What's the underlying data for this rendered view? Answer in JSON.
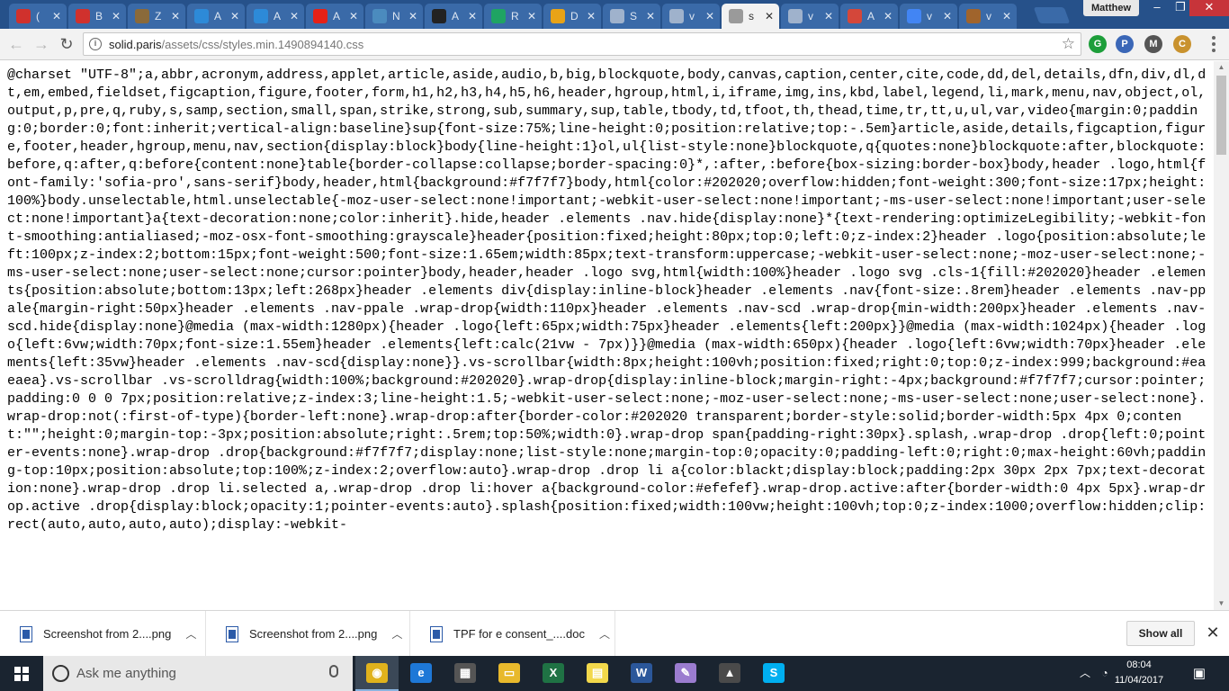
{
  "browser": {
    "tabs": [
      {
        "title": "(",
        "icon": "red-wave-icon",
        "color": "#d0312d"
      },
      {
        "title": "B",
        "icon": "red-wave-icon",
        "color": "#d0312d"
      },
      {
        "title": "Z",
        "icon": "zillow-icon",
        "color": "#8a6a3a"
      },
      {
        "title": "A",
        "icon": "s-logo-icon",
        "color": "#2d8ad8"
      },
      {
        "title": "A",
        "icon": "s-logo-icon",
        "color": "#2d8ad8"
      },
      {
        "title": "A",
        "icon": "youtube-icon",
        "color": "#e62117"
      },
      {
        "title": "N",
        "icon": "python-icon",
        "color": "#4b8bbe"
      },
      {
        "title": "A",
        "icon": "amazon-icon",
        "color": "#222222"
      },
      {
        "title": "R",
        "icon": "drive-icon",
        "color": "#1fa463"
      },
      {
        "title": "D",
        "icon": "download-icon",
        "color": "#e8a317"
      },
      {
        "title": "S",
        "icon": "document-icon",
        "color": "#9fb2cc"
      },
      {
        "title": "v",
        "icon": "document-icon",
        "color": "#9fb2cc"
      },
      {
        "title": "s",
        "icon": "document-icon",
        "color": "#9a9a9a",
        "active": true
      },
      {
        "title": "v",
        "icon": "document-icon",
        "color": "#9fb2cc"
      },
      {
        "title": "A",
        "icon": "tile-icon",
        "color": "#d4473a"
      },
      {
        "title": "v",
        "icon": "google-icon",
        "color": "#4285f4"
      },
      {
        "title": "v",
        "icon": "bug-icon",
        "color": "#a0642c"
      }
    ],
    "tab_close_glyph": "✕",
    "user_name": "Matthew",
    "window_controls": [
      "‒",
      "❐",
      "✕"
    ],
    "nav": {
      "back": "←",
      "forward": "→",
      "reload": "↻"
    },
    "address": {
      "info_glyph": "i",
      "host": "solid.paris",
      "path": "/assets/css/styles.min.1490894140.css"
    },
    "bookmark_glyph": "☆",
    "extensions": [
      {
        "name": "green-extension-icon",
        "label": "G",
        "color": "#1d9e3a"
      },
      {
        "name": "person-extension-icon",
        "label": "P",
        "color": "#3b67b7"
      },
      {
        "name": "gmail-extension-icon",
        "label": "M",
        "color": "#555555"
      },
      {
        "name": "cookie-extension-icon",
        "label": "C",
        "color": "#c9922e"
      }
    ]
  },
  "page": {
    "css_text": "@charset \"UTF-8\";a,abbr,acronym,address,applet,article,aside,audio,b,big,blockquote,body,canvas,caption,center,cite,code,dd,del,details,dfn,div,dl,dt,em,embed,fieldset,figcaption,figure,footer,form,h1,h2,h3,h4,h5,h6,header,hgroup,html,i,iframe,img,ins,kbd,label,legend,li,mark,menu,nav,object,ol,output,p,pre,q,ruby,s,samp,section,small,span,strike,strong,sub,summary,sup,table,tbody,td,tfoot,th,thead,time,tr,tt,u,ul,var,video{margin:0;padding:0;border:0;font:inherit;vertical-align:baseline}sup{font-size:75%;line-height:0;position:relative;top:-.5em}article,aside,details,figcaption,figure,footer,header,hgroup,menu,nav,section{display:block}body{line-height:1}ol,ul{list-style:none}blockquote,q{quotes:none}blockquote:after,blockquote:before,q:after,q:before{content:none}table{border-collapse:collapse;border-spacing:0}*,:after,:before{box-sizing:border-box}body,header .logo,html{font-family:'sofia-pro',sans-serif}body,header,html{background:#f7f7f7}body,html{color:#202020;overflow:hidden;font-weight:300;font-size:17px;height:100%}body.unselectable,html.unselectable{-moz-user-select:none!important;-webkit-user-select:none!important;-ms-user-select:none!important;user-select:none!important}a{text-decoration:none;color:inherit}.hide,header .elements .nav.hide{display:none}*{text-rendering:optimizeLegibility;-webkit-font-smoothing:antialiased;-moz-osx-font-smoothing:grayscale}header{position:fixed;height:80px;top:0;left:0;z-index:2}header .logo{position:absolute;left:100px;z-index:2;bottom:15px;font-weight:500;font-size:1.65em;width:85px;text-transform:uppercase;-webkit-user-select:none;-moz-user-select:none;-ms-user-select:none;user-select:none;cursor:pointer}body,header,header .logo svg,html{width:100%}header .logo svg .cls-1{fill:#202020}header .elements{position:absolute;bottom:13px;left:268px}header .elements div{display:inline-block}header .elements .nav{font-size:.8rem}header .elements .nav-ppale{margin-right:50px}header .elements .nav-ppale .wrap-drop{width:110px}header .elements .nav-scd .wrap-drop{min-width:200px}header .elements .nav-scd.hide{display:none}@media (max-width:1280px){header .logo{left:65px;width:75px}header .elements{left:200px}}@media (max-width:1024px){header .logo{left:6vw;width:70px;font-size:1.55em}header .elements{left:calc(21vw - 7px)}}@media (max-width:650px){header .logo{left:6vw;width:70px}header .elements{left:35vw}header .elements .nav-scd{display:none}}.vs-scrollbar{width:8px;height:100vh;position:fixed;right:0;top:0;z-index:999;background:#eaeaea}.vs-scrollbar .vs-scrolldrag{width:100%;background:#202020}.wrap-drop{display:inline-block;margin-right:-4px;background:#f7f7f7;cursor:pointer;padding:0 0 0 7px;position:relative;z-index:3;line-height:1.5;-webkit-user-select:none;-moz-user-select:none;-ms-user-select:none;user-select:none}.wrap-drop:not(:first-of-type){border-left:none}.wrap-drop:after{border-color:#202020 transparent;border-style:solid;border-width:5px 4px 0;content:\"\";height:0;margin-top:-3px;position:absolute;right:.5rem;top:50%;width:0}.wrap-drop span{padding-right:30px}.splash,.wrap-drop .drop{left:0;pointer-events:none}.wrap-drop .drop{background:#f7f7f7;display:none;list-style:none;margin-top:0;opacity:0;padding-left:0;right:0;max-height:60vh;padding-top:10px;position:absolute;top:100%;z-index:2;overflow:auto}.wrap-drop .drop li a{color:blackt;display:block;padding:2px 30px 2px 7px;text-decoration:none}.wrap-drop .drop li.selected a,.wrap-drop .drop li:hover a{background-color:#efefef}.wrap-drop.active:after{border-width:0 4px 5px}.wrap-drop.active .drop{display:block;opacity:1;pointer-events:auto}.splash{position:fixed;width:100vw;height:100vh;top:0;z-index:1000;overflow:hidden;clip:rect(auto,auto,auto,auto);display:-webkit-"
  },
  "downloads": {
    "items": [
      {
        "name": "Screenshot from 2....png",
        "chevron": "︿"
      },
      {
        "name": "Screenshot from 2....png",
        "chevron": "︿"
      },
      {
        "name": "TPF for e consent_....doc",
        "chevron": "︿"
      }
    ],
    "show_all": "Show all",
    "close_glyph": "✕"
  },
  "taskbar": {
    "search_placeholder": "Ask me anything",
    "apps": [
      {
        "name": "chrome-taskbar-icon",
        "label": "◉",
        "color": "#e0b21c",
        "active": true
      },
      {
        "name": "edge-taskbar-icon",
        "label": "e",
        "color": "#1e78d7"
      },
      {
        "name": "calculator-taskbar-icon",
        "label": "▦",
        "color": "#555555"
      },
      {
        "name": "file-explorer-taskbar-icon",
        "label": "▭",
        "color": "#e8b92c"
      },
      {
        "name": "excel-taskbar-icon",
        "label": "X",
        "color": "#1f7244"
      },
      {
        "name": "sticky-notes-taskbar-icon",
        "label": "▤",
        "color": "#f2d84b"
      },
      {
        "name": "word-taskbar-icon",
        "label": "W",
        "color": "#2b579a"
      },
      {
        "name": "paint-taskbar-icon",
        "label": "✎",
        "color": "#9b7ccf"
      },
      {
        "name": "photos-taskbar-icon",
        "label": "▲",
        "color": "#4a4a4a"
      },
      {
        "name": "skype-taskbar-icon",
        "label": "S",
        "color": "#00aff0"
      }
    ],
    "tray": {
      "chevron": "︿",
      "network": "◔",
      "volume": "♪",
      "notifications": "▣"
    },
    "clock": {
      "time": "08:04",
      "date": "11/04/2017"
    }
  }
}
